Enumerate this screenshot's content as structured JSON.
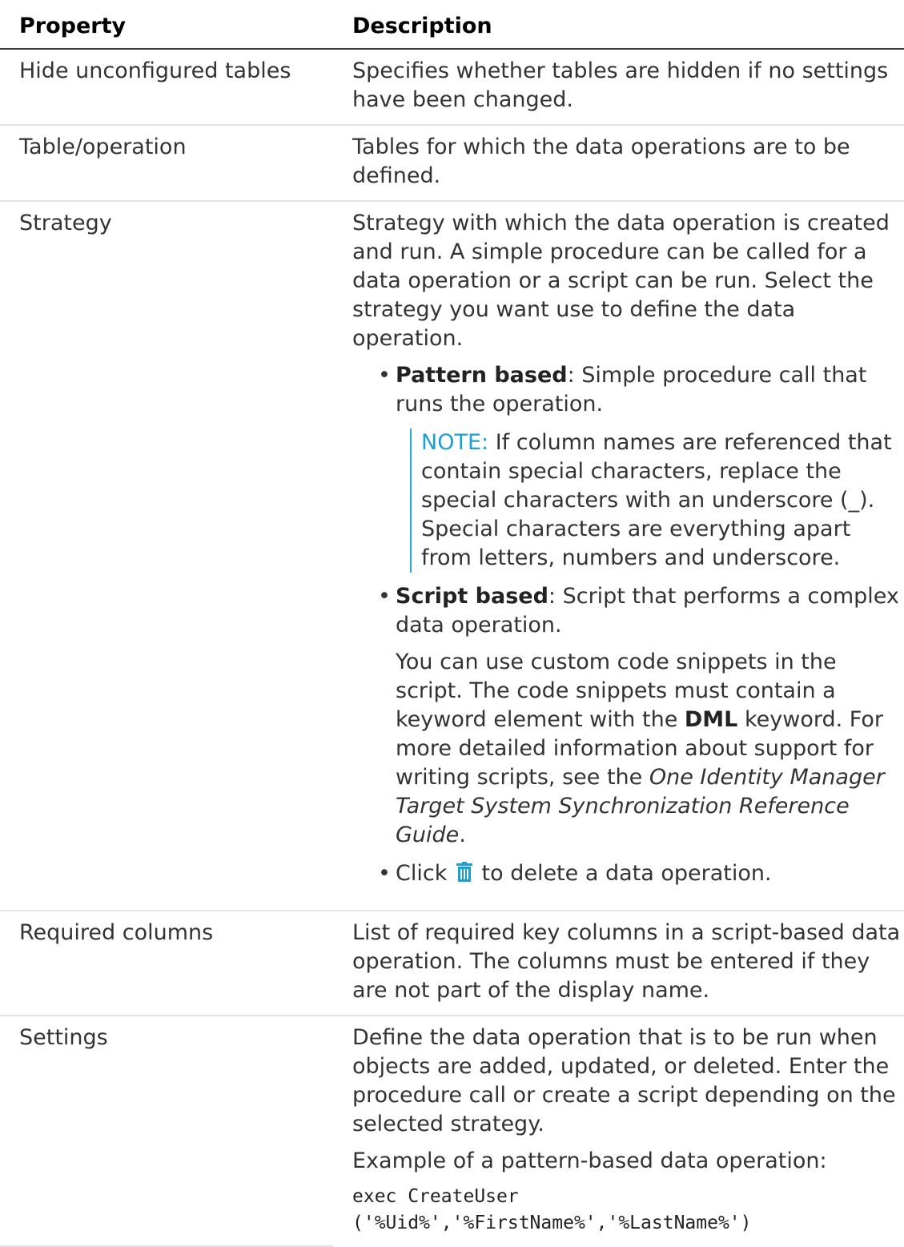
{
  "header": {
    "property": "Property",
    "description": "Description"
  },
  "rows": [
    {
      "property": "Hide unconfigured tables",
      "description": "Specifies whether tables are hidden if no settings have been changed."
    },
    {
      "property": "Table/operation",
      "description": "Tables for which the data operations are to be defined."
    },
    {
      "property": "Strategy",
      "description": "Strategy with which the data operation is created and run. A simple procedure can be called for a data operation or a script can be run. Select the strategy you want use to define the data operation.",
      "bullets": {
        "pattern_term": "Pattern based",
        "pattern_text": ": Simple procedure call that runs the operation.",
        "note_label": "NOTE:",
        "note_text": " If column names are referenced that contain special characters, replace the special characters with an underscore (_). Special characters are everything apart from letters, numbers and underscore.",
        "script_term": "Script based",
        "script_text": ": Script that performs a complex data operation.",
        "script_p_1": "You can use custom code snippets in the script. The code snippets must contain a keyword element with the ",
        "script_p_kw": "DML",
        "script_p_2": " keyword. For more detailed information about support for writing scripts, see the ",
        "script_p_ref": "One Identity Manager Target System Synchronization Reference Guide",
        "script_p_3": ".",
        "click_1": "Click ",
        "click_icon": "trash-icon",
        "click_2": " to delete a data operation."
      }
    },
    {
      "property": "Required columns",
      "description": "List of required key columns in a script-based data operation. The columns must be entered if they are not part of the display name."
    },
    {
      "property": "Settings",
      "description": "Define the data operation that is to be run when objects are added, updated, or deleted. Enter the procedure call or create a script depending on the selected strategy.",
      "example_label": "Example of a pattern-based data operation:",
      "code_line_1": "exec CreateUser",
      "code_line_2": "('%Uid%','%FirstName%','%LastName%')"
    }
  ],
  "colors": {
    "note_accent": "#1ba0d6",
    "icon": "#1ba0d6"
  }
}
